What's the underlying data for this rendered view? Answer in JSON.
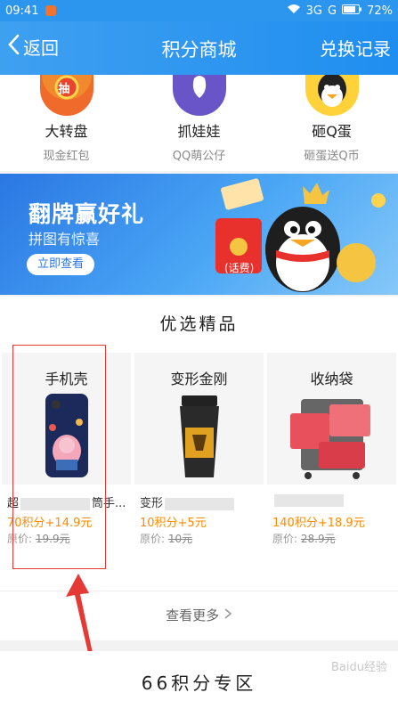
{
  "status_bar": {
    "time": "09:41",
    "network": "3G",
    "network2": "G",
    "battery": "72%"
  },
  "nav": {
    "back_label": "返回",
    "title": "积分商城",
    "right_label": "兑换记录"
  },
  "categories": [
    {
      "name": "大转盘",
      "sub": "现金红包",
      "icon": "lottery-wheel-icon",
      "badge": "抽"
    },
    {
      "name": "抓娃娃",
      "sub": "QQ萌公仔",
      "icon": "claw-machine-icon"
    },
    {
      "name": "砸Q蛋",
      "sub": "砸蛋送Q币",
      "icon": "penguin-egg-icon"
    }
  ],
  "banner": {
    "title": "翻牌赢好礼",
    "subtitle": "拼图有惊喜",
    "button": "立即查看",
    "badge": "(话费)"
  },
  "section": {
    "title": "优选精品",
    "products": [
      {
        "name": "手机壳",
        "desc_prefix": "超",
        "desc_suffix": "筒手...",
        "price": "70积分+14.9元",
        "orig_label": "原价:",
        "orig_price": "19.9元"
      },
      {
        "name": "变形金刚",
        "desc_prefix": "变形",
        "desc_suffix": "",
        "price": "10积分+5元",
        "orig_label": "原价:",
        "orig_price": "10元"
      },
      {
        "name": "收纳袋",
        "desc_prefix": "",
        "desc_suffix": "",
        "price": "140积分+18.9元",
        "orig_label": "原价:",
        "orig_price": "28.9元"
      }
    ],
    "more": "查看更多"
  },
  "zone": {
    "title": "66积分专区"
  },
  "watermark": "Baidu经验",
  "colors": {
    "accent": "#2c95ee",
    "price": "#ff8a00",
    "highlight": "#e53935"
  }
}
